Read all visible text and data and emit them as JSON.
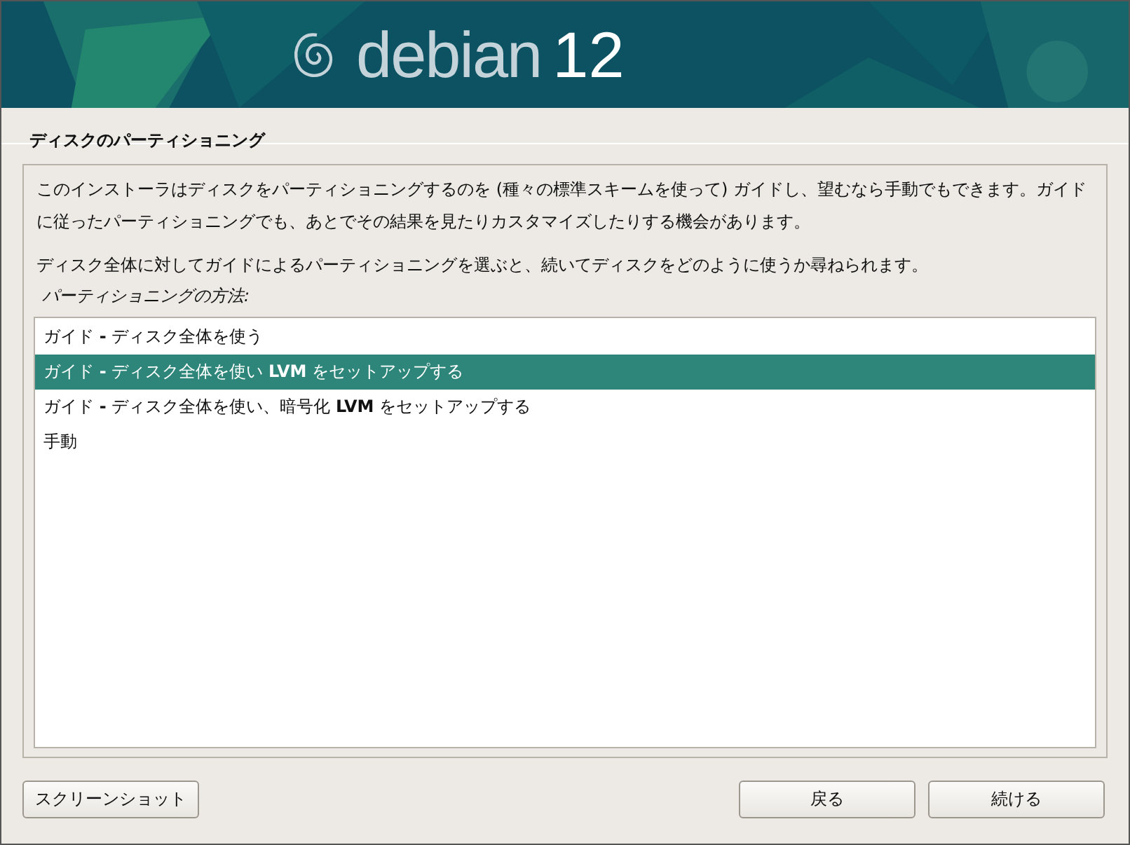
{
  "banner": {
    "logo_text": "debian",
    "version": "12"
  },
  "page_title": "ディスクのパーティショニング",
  "paragraphs": [
    "このインストーラはディスクをパーティショニングするのを (種々の標準スキームを使って) ガイドし、望むなら手動でもできます。ガイドに従ったパーティショニングでも、あとでその結果を見たりカスタマイズしたりする機会があります。",
    "ディスク全体に対してガイドによるパーティショニングを選ぶと、続いてディスクをどのように使うか尋ねられます。"
  ],
  "list_label": "パーティショニングの方法:",
  "options": [
    {
      "label": "ガイド **-** ディスク全体を使う",
      "selected": false
    },
    {
      "label": "ガイド **-** ディスク全体を使い **LVM** をセットアップする",
      "selected": true
    },
    {
      "label": "ガイド **-** ディスク全体を使い、暗号化 **LVM** をセットアップする",
      "selected": false
    },
    {
      "label": "手動",
      "selected": false
    }
  ],
  "buttons": {
    "screenshot": "スクリーンショット",
    "back": "戻る",
    "continue": "続ける"
  }
}
